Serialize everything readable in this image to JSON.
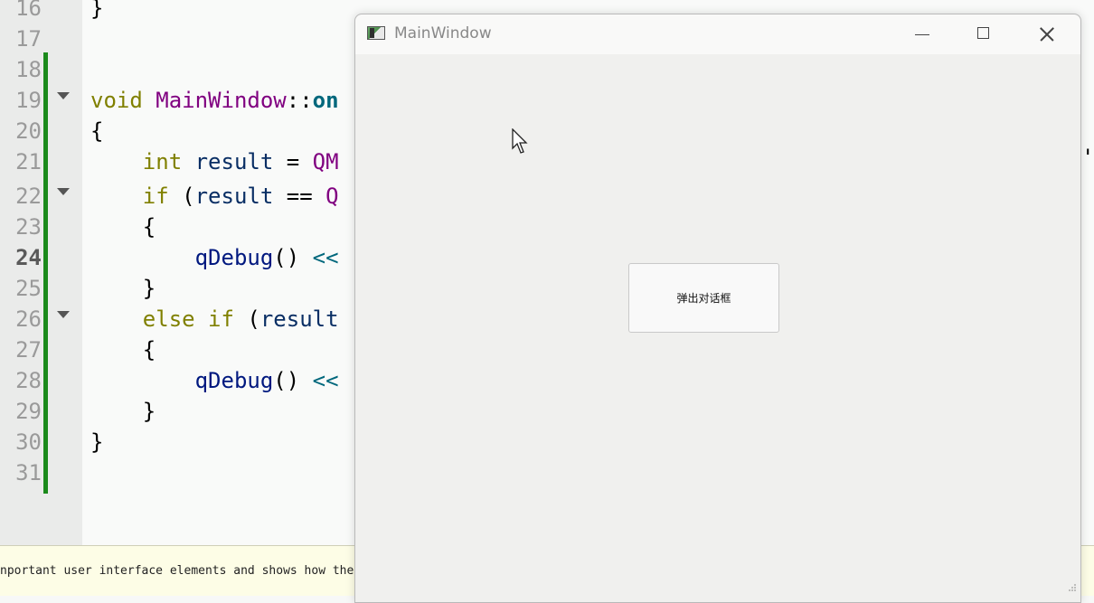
{
  "editor": {
    "line_numbers": [
      "16",
      "17",
      "18",
      "19",
      "20",
      "21",
      "22",
      "23",
      "24",
      "25",
      "26",
      "27",
      "28",
      "29",
      "30",
      "31"
    ],
    "current_line": "24",
    "lines": {
      "l16": "}",
      "l19_void": "void",
      "l19_func": "MainWindow",
      "l19_sep": "::",
      "l19_slot": "on",
      "l20": "{",
      "l21_type": "int",
      "l21_var": "result",
      "l21_eq": " = ",
      "l21_cls": "QM",
      "l22_if": "if",
      "l22_open": " (",
      "l22_var": "result",
      "l22_op": " == ",
      "l22_cls": "Q",
      "l23": "{",
      "l24_call": "qDebug",
      "l24_paren": "()",
      "l24_shift": " <<",
      "l25": "}",
      "l26_else": "else if",
      "l26_open": " (",
      "l26_var": "result",
      "l27": "{",
      "l28_call": "qDebug",
      "l28_paren": "()",
      "l28_shift": " <<",
      "l29": "}",
      "l30": "}"
    },
    "edge_chars": "',"
  },
  "output": {
    "text": "nportant user interface elements and shows how the"
  },
  "window": {
    "title": "MainWindow",
    "icon": "qt-app-icon",
    "controls": [
      "minimize-icon",
      "maximize-icon",
      "close-icon"
    ],
    "button_label": "弹出对话框"
  },
  "colors": {
    "keyword": "#808000",
    "function": "#800080",
    "identifier": "#092e64",
    "change_bar": "#1b8a1b",
    "window_bg": "#f0f0ee"
  }
}
